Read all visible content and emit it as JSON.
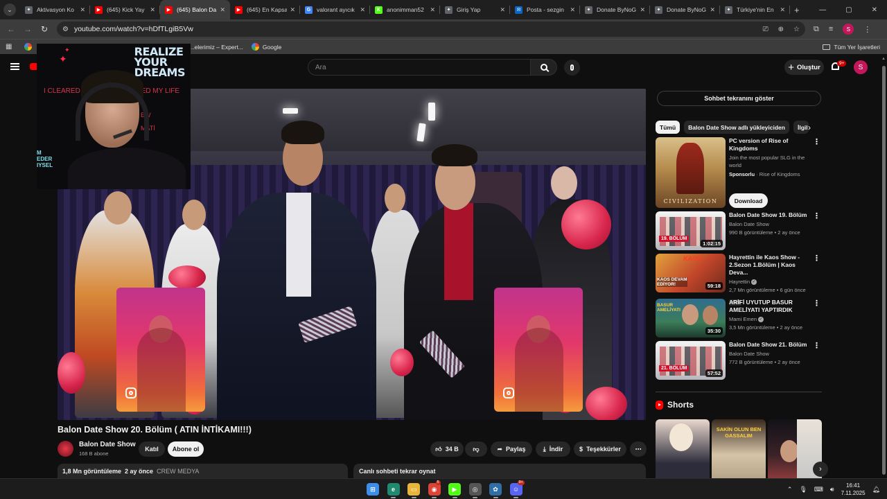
{
  "browser": {
    "tabs": [
      {
        "title": "Aktivasyon Ko",
        "fav_color": "#5f6368",
        "fav_glyph": "✦",
        "active": false
      },
      {
        "title": "(645) Kick Yay",
        "fav_color": "#ff0000",
        "fav_glyph": "▶",
        "active": false
      },
      {
        "title": "(645) Balon Da",
        "fav_color": "#ff0000",
        "fav_glyph": "▶",
        "active": true
      },
      {
        "title": "(645) En Kapsa",
        "fav_color": "#ff0000",
        "fav_glyph": "▶",
        "active": false
      },
      {
        "title": "valorant ayıcık",
        "fav_color": "#4285f4",
        "fav_glyph": "G",
        "active": false
      },
      {
        "title": "anonimman52",
        "fav_color": "#53fc18",
        "fav_glyph": "K",
        "active": false
      },
      {
        "title": "Giriş Yap",
        "fav_color": "#5f6368",
        "fav_glyph": "✦",
        "active": false
      },
      {
        "title": "Posta - sezgin",
        "fav_color": "#0a66c2",
        "fav_glyph": "✉",
        "active": false
      },
      {
        "title": "Donate ByNoG",
        "fav_color": "#5f6368",
        "fav_glyph": "✦",
        "active": false
      },
      {
        "title": "Donate ByNoG",
        "fav_color": "#5f6368",
        "fav_glyph": "✦",
        "active": false
      },
      {
        "title": "Türkiye'nin En",
        "fav_color": "#5f6368",
        "fav_glyph": "✦",
        "active": false
      }
    ],
    "url": "youtube.com/watch?v=hDfTLgiB5Vw",
    "bookmarks": [
      {
        "label": "...elerimiz – Expert..."
      },
      {
        "label": "Google"
      }
    ],
    "all_bookmarks_label": "Tüm Yer İşaretleri",
    "profile_initial": "S"
  },
  "youtube": {
    "search_placeholder": "Ara",
    "create_label": "Oluştur",
    "notif_count": "9+",
    "avatar_initial": "S",
    "webcam_overlay": {
      "line1": "REALIZE",
      "line2": "YOUR",
      "line3": "DREAMS",
      "red1": "I CLEARED",
      "red1b": "ARED MY LIFE",
      "red2": "EW",
      "red3": "MATİ",
      "teal": "M\nEDER\nIYSEL"
    },
    "video": {
      "title": "Balon Date Show 20. Bölüm ( ATIN İNTİKAMI!!!)",
      "channel": "Balon Date Show",
      "subscribers": "168 B abone",
      "join_label": "Katıl",
      "subscribe_label": "Abone ol",
      "likes": "34 B",
      "share_label": "Paylaş",
      "download_label": "İndir",
      "thanks_label": "Teşekkürler",
      "views": "1,8 Mn görüntüleme",
      "uploaded": "2 ay önce",
      "tag": "CREW MEDYA",
      "chat_replay_label": "Canlı sohbeti tekrar oynat"
    },
    "sidebar": {
      "show_chat_label": "Sohbet tekranını göster",
      "chips": [
        {
          "label": "Tümü",
          "active": true
        },
        {
          "label": "Balon Date Show adlı yükleyiciden",
          "active": false
        },
        {
          "label": "İlgil",
          "active": false
        }
      ],
      "ad": {
        "title": "PC version of Rise of Kingdoms",
        "desc": "Join the most popular SLG in the world",
        "sponsor": "Sponsorlu",
        "advertiser": "Rise of Kingdoms",
        "thumb_text": "CIVILIZATION",
        "cta": "Download"
      },
      "recommendations": [
        {
          "title": "Balon Date Show 19. Bölüm",
          "channel": "Balon Date Show",
          "verified": false,
          "views": "990 B görüntüleme",
          "age": "2 ay önce",
          "duration": "1:02:15",
          "thumb_label": "19. BÖLÜM",
          "new_label": ""
        },
        {
          "title": "Hayrettin ile Kaos Show - 2.Sezon 1.Bölüm | Kaos Deva...",
          "channel": "Hayrettin",
          "verified": true,
          "views": "2,7 Mn görüntüleme",
          "age": "6 gün önce",
          "duration": "59:18",
          "thumb_label": "KAOS DEVAM EDİYOR!",
          "new_label": "Yeni"
        },
        {
          "title": "ARİFİ UYUTUP BASUR AMELİYATI YAPTIRDIK",
          "channel": "Mami Emen",
          "verified": true,
          "views": "3,5 Mn görüntüleme",
          "age": "2 ay önce",
          "duration": "35:30",
          "thumb_label": "BASUR AMELİYATI",
          "new_label": ""
        },
        {
          "title": "Balon Date Show 21. Bölüm",
          "channel": "Balon Date Show",
          "verified": false,
          "views": "772 B görüntüleme",
          "age": "2 ay önce",
          "duration": "57:52",
          "thumb_label": "21. BÖLÜM",
          "new_label": ""
        }
      ],
      "shorts_title": "Shorts",
      "shorts": [
        {
          "caption": "",
          "colors": [
            "#2c2c3a",
            "#e9d8ce"
          ]
        },
        {
          "caption": "SAKİN OLUN BEN GASSALIM",
          "colors": [
            "#3a2a1e",
            "#d6c4a8"
          ]
        },
        {
          "caption": "",
          "colors": [
            "#121218",
            "#8a3a3a"
          ]
        },
        {
          "caption": "",
          "colors": [
            "#c8c8c8",
            "#e8e2d8"
          ]
        }
      ]
    }
  },
  "taskbar": {
    "apps": [
      {
        "name": "windows-start",
        "color": "#3b8eea",
        "glyph": "⊞"
      },
      {
        "name": "edge",
        "color": "#1f8a70",
        "glyph": "e"
      },
      {
        "name": "file-explorer",
        "color": "#e8b43a",
        "glyph": "▭"
      },
      {
        "name": "chrome",
        "color": "#db4437",
        "glyph": "◉",
        "badge": "5"
      },
      {
        "name": "kick",
        "color": "#53fc18",
        "glyph": "▶"
      },
      {
        "name": "app-6",
        "color": "#555",
        "glyph": "◎"
      },
      {
        "name": "app-7",
        "color": "#2f6fa6",
        "glyph": "✿"
      },
      {
        "name": "discord",
        "color": "#5865f2",
        "glyph": "☺",
        "badge": "9+"
      }
    ],
    "time": "16:41",
    "date": "7.11.2025"
  }
}
